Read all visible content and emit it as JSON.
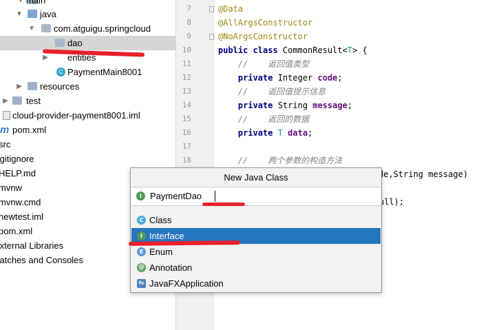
{
  "project_tree": {
    "items": [
      {
        "label": "main"
      },
      {
        "label": "java"
      },
      {
        "label": "com.atguigu.springcloud"
      },
      {
        "label": "dao"
      },
      {
        "label": "entities"
      },
      {
        "label": "PaymentMain8001"
      },
      {
        "label": "resources"
      },
      {
        "label": "test"
      },
      {
        "label": "cloud-provider-payment8001.iml"
      },
      {
        "label": "pom.xml"
      },
      {
        "label": "src"
      },
      {
        "label": ".gitignore"
      },
      {
        "label": "HELP.md"
      },
      {
        "label": "mvnw"
      },
      {
        "label": "mvnw.cmd"
      },
      {
        "label": "newtest.iml"
      },
      {
        "label": "pom.xml"
      },
      {
        "label": "External Libraries"
      },
      {
        "label": "Scratches and Consoles"
      }
    ]
  },
  "editor": {
    "line_numbers": [
      "7",
      "8",
      "9",
      "10",
      "11",
      "12",
      "13",
      "14",
      "15",
      "16",
      "17",
      "18"
    ],
    "lines": [
      [
        "@Data"
      ],
      [
        "@AllArgsConstructor"
      ],
      [
        "@NoArgsConstructor"
      ],
      [
        "public class ",
        "CommonResult<",
        "T",
        "> {"
      ],
      [
        "    //    返回值类型"
      ],
      [
        "    private ",
        "Integer ",
        "code",
        ";"
      ],
      [
        "    //    返回值提示信息"
      ],
      [
        "    private ",
        "String ",
        "message",
        ";"
      ],
      [
        "    //    返回的数据"
      ],
      [
        "    private ",
        "T ",
        "data",
        ";"
      ],
      [
        ""
      ],
      [
        "    //    两个参数的构造方法"
      ]
    ],
    "visible_fragments": {
      "line_19_tail": "de,String message)",
      "line_21_tail": "ull);"
    }
  },
  "dialog": {
    "title": "New Java Class",
    "name_value": "PaymentDao",
    "kinds": [
      {
        "label": "Class",
        "icon": "C"
      },
      {
        "label": "Interface",
        "icon": "I"
      },
      {
        "label": "Enum",
        "icon": "E"
      },
      {
        "label": "Annotation",
        "icon": "@"
      },
      {
        "label": "JavaFXApplication",
        "icon": "fx"
      }
    ],
    "selected_kind": "Interface",
    "input_icon": "I"
  },
  "colors": {
    "selection": "#2675bf",
    "annotation_mark": "#e8202a"
  }
}
